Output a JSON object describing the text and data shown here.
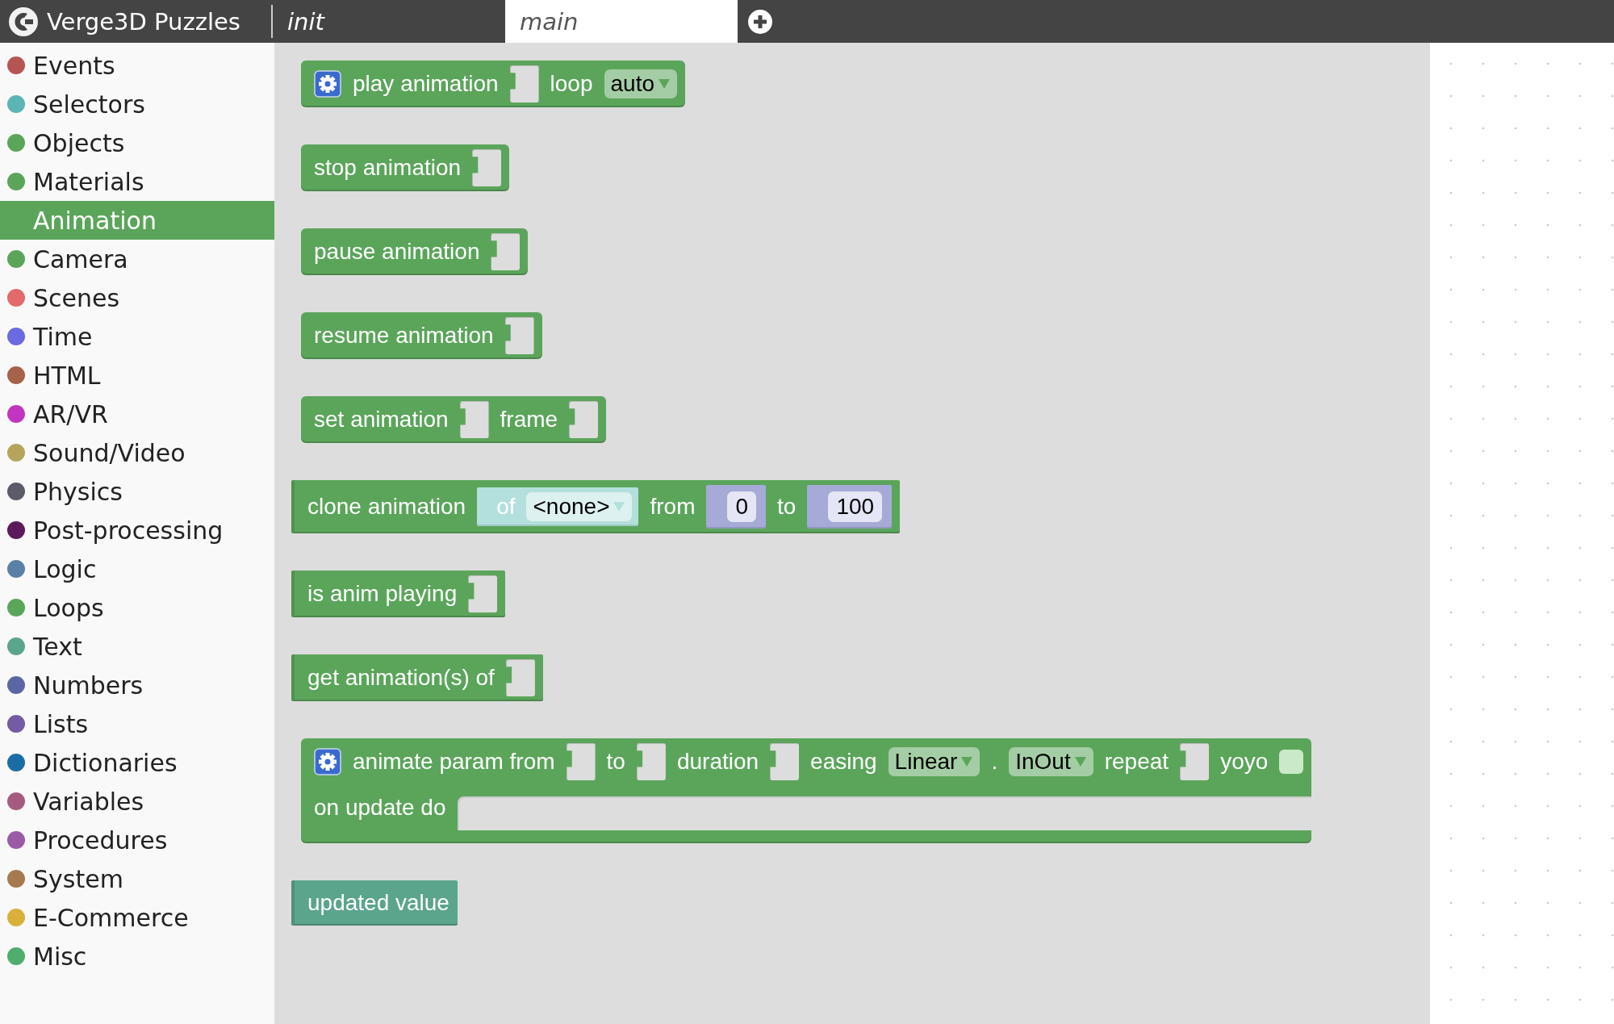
{
  "app_title": "Verge3D Puzzles",
  "tabs": [
    {
      "label": "init",
      "selected": false
    },
    {
      "label": "main",
      "selected": true
    }
  ],
  "categories": [
    {
      "name": "Events",
      "color": "#b65353",
      "selected": false
    },
    {
      "name": "Selectors",
      "color": "#5bb5b5",
      "selected": false
    },
    {
      "name": "Objects",
      "color": "#5ba55b",
      "selected": false
    },
    {
      "name": "Materials",
      "color": "#5ba55b",
      "selected": false
    },
    {
      "name": "Animation",
      "color": "#5ba55b",
      "selected": true
    },
    {
      "name": "Camera",
      "color": "#5ba55b",
      "selected": false
    },
    {
      "name": "Scenes",
      "color": "#e26a6a",
      "selected": false
    },
    {
      "name": "Time",
      "color": "#6a6ae2",
      "selected": false
    },
    {
      "name": "HTML",
      "color": "#a5634a",
      "selected": false
    },
    {
      "name": "AR/VR",
      "color": "#c234c2",
      "selected": false
    },
    {
      "name": "Sound/Video",
      "color": "#b5a55b",
      "selected": false
    },
    {
      "name": "Physics",
      "color": "#5b5b6a",
      "selected": false
    },
    {
      "name": "Post-processing",
      "color": "#5b1a5b",
      "selected": false
    },
    {
      "name": "Logic",
      "color": "#5b80a5",
      "selected": false
    },
    {
      "name": "Loops",
      "color": "#5ba55b",
      "selected": false
    },
    {
      "name": "Text",
      "color": "#5ba58c",
      "selected": false
    },
    {
      "name": "Numbers",
      "color": "#5b67a5",
      "selected": false
    },
    {
      "name": "Lists",
      "color": "#745ba5",
      "selected": false
    },
    {
      "name": "Dictionaries",
      "color": "#1a6ea5",
      "selected": false
    },
    {
      "name": "Variables",
      "color": "#a55b80",
      "selected": false
    },
    {
      "name": "Procedures",
      "color": "#995ba5",
      "selected": false
    },
    {
      "name": "System",
      "color": "#a57a4e",
      "selected": false
    },
    {
      "name": "E-Commerce",
      "color": "#d9b13a",
      "selected": false
    },
    {
      "name": "Misc",
      "color": "#4fae6d",
      "selected": false
    }
  ],
  "blocks": [
    {
      "kind": "statement",
      "color": "#5ba55b",
      "gear": true,
      "rows": [
        [
          {
            "kind": "label",
            "text": "play animation"
          },
          {
            "kind": "socket"
          },
          {
            "kind": "label",
            "text": "loop"
          },
          {
            "kind": "dropdown",
            "text": "auto"
          }
        ]
      ]
    },
    {
      "kind": "statement",
      "color": "#5ba55b",
      "gear": false,
      "rows": [
        [
          {
            "kind": "label",
            "text": "stop animation"
          },
          {
            "kind": "socket"
          }
        ]
      ]
    },
    {
      "kind": "statement",
      "color": "#5ba55b",
      "gear": false,
      "rows": [
        [
          {
            "kind": "label",
            "text": "pause animation"
          },
          {
            "kind": "socket"
          }
        ]
      ]
    },
    {
      "kind": "statement",
      "color": "#5ba55b",
      "gear": false,
      "rows": [
        [
          {
            "kind": "label",
            "text": "resume animation"
          },
          {
            "kind": "socket"
          }
        ]
      ]
    },
    {
      "kind": "statement",
      "color": "#5ba55b",
      "gear": false,
      "rows": [
        [
          {
            "kind": "label",
            "text": "set animation"
          },
          {
            "kind": "socket"
          },
          {
            "kind": "label",
            "text": "frame"
          },
          {
            "kind": "socket"
          }
        ]
      ]
    },
    {
      "kind": "output",
      "color": "#5ba55b",
      "gear": false,
      "rows": [
        [
          {
            "kind": "label",
            "text": "clone animation"
          },
          {
            "kind": "object",
            "color": "#b3e0dd",
            "label": "of",
            "value": "<none>"
          },
          {
            "kind": "label",
            "text": "from"
          },
          {
            "kind": "number",
            "color": "#a5aad6",
            "value": "0"
          },
          {
            "kind": "label",
            "text": "to"
          },
          {
            "kind": "number",
            "color": "#a5aad6",
            "value": "100"
          }
        ]
      ]
    },
    {
      "kind": "output",
      "color": "#5ba55b",
      "gear": false,
      "rows": [
        [
          {
            "kind": "label",
            "text": "is anim playing"
          },
          {
            "kind": "socket"
          }
        ]
      ]
    },
    {
      "kind": "output",
      "color": "#5ba55b",
      "gear": false,
      "rows": [
        [
          {
            "kind": "label",
            "text": "get animation(s) of"
          },
          {
            "kind": "socket"
          }
        ]
      ]
    },
    {
      "kind": "statement",
      "color": "#5ba55b",
      "gear": true,
      "rows": [
        [
          {
            "kind": "label",
            "text": "animate param from"
          },
          {
            "kind": "socket"
          },
          {
            "kind": "label",
            "text": "to"
          },
          {
            "kind": "socket"
          },
          {
            "kind": "label",
            "text": "duration"
          },
          {
            "kind": "socket"
          },
          {
            "kind": "label",
            "text": "easing"
          },
          {
            "kind": "dropdown",
            "text": "Linear"
          },
          {
            "kind": "label",
            "text": "."
          },
          {
            "kind": "dropdown",
            "text": "InOut"
          },
          {
            "kind": "label",
            "text": "repeat"
          },
          {
            "kind": "socket"
          },
          {
            "kind": "label",
            "text": "yoyo"
          },
          {
            "kind": "checkbox",
            "checked": false
          }
        ],
        [
          {
            "kind": "label",
            "text": "on update do"
          },
          {
            "kind": "statement_input"
          }
        ]
      ]
    },
    {
      "kind": "output",
      "color": "#5ba58c",
      "gear": false,
      "rows": [
        [
          {
            "kind": "label",
            "text": "updated value"
          }
        ]
      ]
    }
  ]
}
